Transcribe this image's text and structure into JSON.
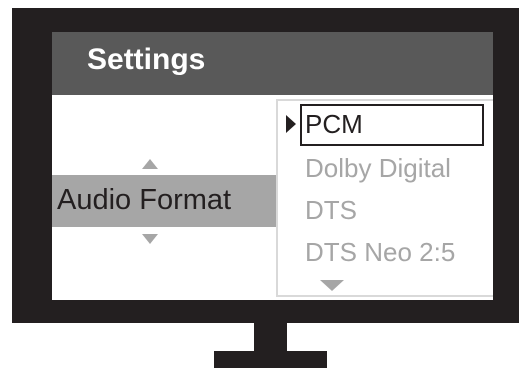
{
  "screen": {
    "title": "Settings"
  },
  "setting": {
    "label": "Audio Format"
  },
  "dropdown": {
    "options": [
      {
        "label": "PCM",
        "selected": true
      },
      {
        "label": "Dolby Digital",
        "selected": false
      },
      {
        "label": "DTS",
        "selected": false
      },
      {
        "label": "DTS Neo 2:5",
        "selected": false
      }
    ]
  },
  "icons": {
    "scroll_up": "triangle-up-icon",
    "scroll_down": "triangle-down-icon",
    "pointer": "triangle-right-icon",
    "more_below": "triangle-down-icon"
  },
  "colors": {
    "bezel": "#231f20",
    "title_bar": "#595959",
    "highlight_row": "#a6a6a6",
    "inactive_text": "#a6a6a6",
    "active_text": "#231f20"
  }
}
